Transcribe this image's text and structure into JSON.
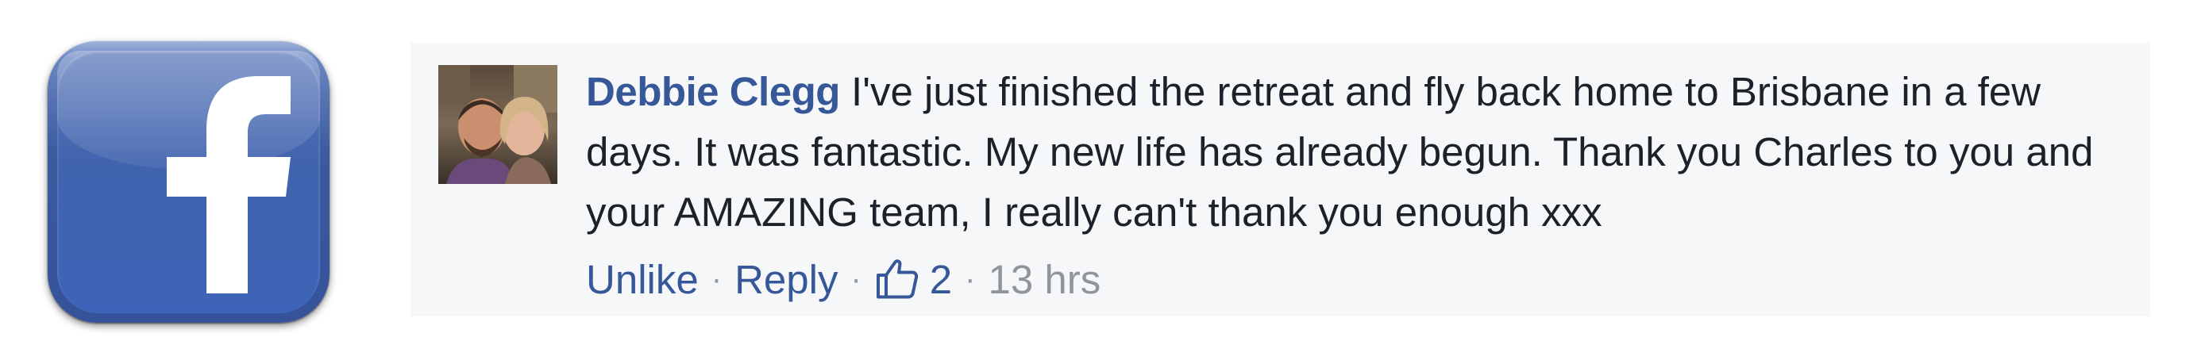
{
  "logo": {
    "icon": "facebook-app-icon",
    "colors": {
      "brand_blue": "#3b5998",
      "letter": "#ffffff"
    }
  },
  "comment": {
    "avatar_icon": "couple-photo-avatar",
    "author": "Debbie Clegg",
    "text": "I've just finished the retreat and fly back home to Brisbane in a few days. It was fantastic. My new life has already begun. Thank you Charles to you and your AMAZING team, I really can't thank you enough xxx",
    "actions": {
      "unlike_label": "Unlike",
      "reply_label": "Reply",
      "separator": "·",
      "like_icon": "thumbs-up-icon",
      "like_count": "2",
      "timestamp": "13 hrs"
    },
    "colors": {
      "link": "#365899",
      "text": "#1d2129",
      "muted": "#90949c",
      "background": "#f6f7f9"
    }
  }
}
